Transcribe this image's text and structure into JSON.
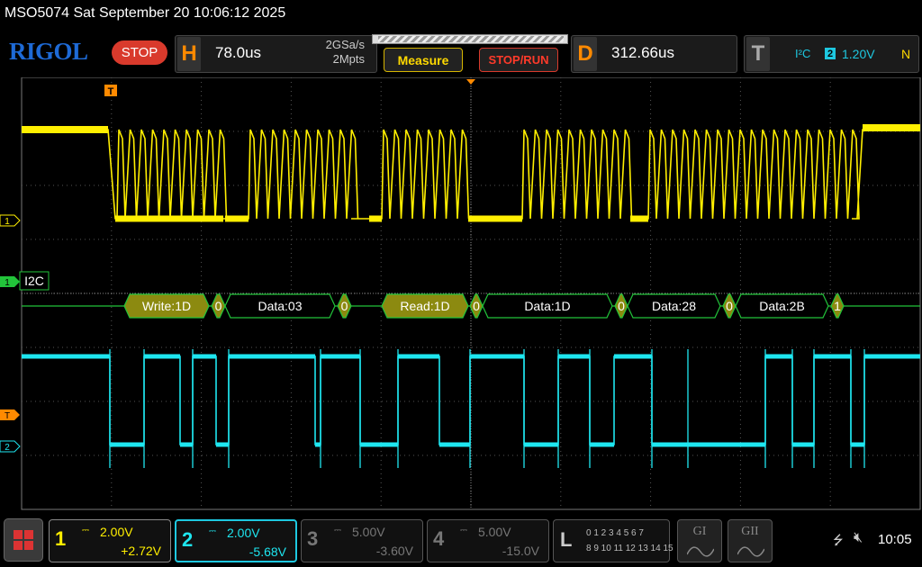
{
  "title": "MSO5074  Sat September 20 10:06:12 2025",
  "brand": "RIGOL",
  "run_status": "STOP",
  "horizontal": {
    "letter": "H",
    "timebase": "78.0us",
    "sample_rate": "2GSa/s",
    "memory_depth": "2Mpts"
  },
  "buttons": {
    "measure": "Measure",
    "stop_run": "STOP/RUN"
  },
  "delay": {
    "letter": "D",
    "value": "312.66us"
  },
  "trigger": {
    "letter": "T",
    "source": "I²C",
    "channel": "2",
    "level": "1.20V",
    "mode": "N"
  },
  "markers": {
    "trigger_pos": "T",
    "ch1": "1",
    "bus1": "1",
    "ch2_trig": "T",
    "ch2": "2",
    "bus_label": "I2C"
  },
  "decode_packets": [
    {
      "label": "Write:1D",
      "kind": "addr"
    },
    {
      "label": "0",
      "kind": "ack"
    },
    {
      "label": "Data:03",
      "kind": "data"
    },
    {
      "label": "0",
      "kind": "ack"
    },
    {
      "label": "Read:1D",
      "kind": "addr"
    },
    {
      "label": "0",
      "kind": "ack"
    },
    {
      "label": "Data:1D",
      "kind": "data"
    },
    {
      "label": "0",
      "kind": "ack"
    },
    {
      "label": "Data:28",
      "kind": "data"
    },
    {
      "label": "0",
      "kind": "ack"
    },
    {
      "label": "Data:2B",
      "kind": "data"
    },
    {
      "label": "1",
      "kind": "ack"
    }
  ],
  "channels": [
    {
      "num": "1",
      "scale": "2.00V",
      "offset": "+2.72V",
      "color": "#ffef00"
    },
    {
      "num": "2",
      "scale": "2.00V",
      "offset": "-5.68V",
      "color": "#1ee6f0"
    },
    {
      "num": "3",
      "scale": "5.00V",
      "offset": "-3.60V",
      "color": "#777777"
    },
    {
      "num": "4",
      "scale": "5.00V",
      "offset": "-15.0V",
      "color": "#777777"
    }
  ],
  "logic": {
    "letter": "L",
    "row1": "0 1 2 3  4 5 6 7",
    "row2": "8 9 10 11 12 13 14 15"
  },
  "bus_buttons": {
    "bus1": "GI",
    "bus2": "GII"
  },
  "status": {
    "clock": "10:05"
  },
  "icons": {
    "menu": "menu-grid-icon",
    "usb": "usb-icon",
    "sound": "speaker-muted-icon"
  }
}
